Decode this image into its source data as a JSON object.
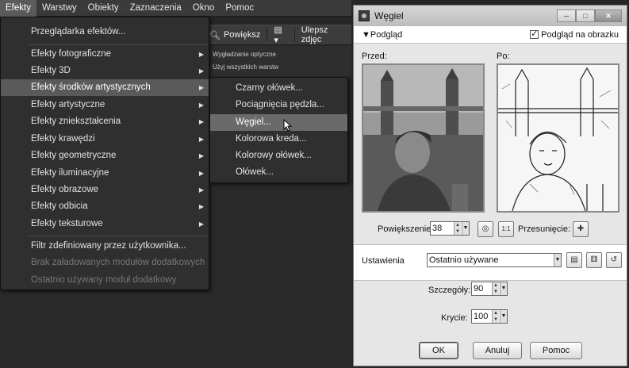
{
  "menubar": {
    "items": [
      "Efekty",
      "Warstwy",
      "Obiekty",
      "Zaznaczenia",
      "Okno",
      "Pomoc"
    ]
  },
  "toolbar": {
    "zoom_label": "Powiększ",
    "enhance_label": "Ulepsz zdjęc"
  },
  "panel": {
    "items": [
      "Wygładzanie optyczne",
      "Użyj wszystkich warstw"
    ]
  },
  "menu": {
    "items": [
      {
        "label": "Przeglądarka efektów...",
        "submenu": false,
        "disabled": false
      },
      {
        "label": "Efekty fotograficzne",
        "submenu": true,
        "disabled": false
      },
      {
        "label": "Efekty 3D",
        "submenu": true,
        "disabled": false
      },
      {
        "label": "Efekty środków artystycznych",
        "submenu": true,
        "disabled": false,
        "selected": true
      },
      {
        "label": "Efekty artystyczne",
        "submenu": true,
        "disabled": false
      },
      {
        "label": "Efekty zniekształcenia",
        "submenu": true,
        "disabled": false
      },
      {
        "label": "Efekty krawędzi",
        "submenu": true,
        "disabled": false
      },
      {
        "label": "Efekty geometryczne",
        "submenu": true,
        "disabled": false
      },
      {
        "label": "Efekty iluminacyjne",
        "submenu": true,
        "disabled": false
      },
      {
        "label": "Efekty obrazowe",
        "submenu": true,
        "disabled": false
      },
      {
        "label": "Efekty odbicia",
        "submenu": true,
        "disabled": false
      },
      {
        "label": "Efekty teksturowe",
        "submenu": true,
        "disabled": false
      },
      {
        "label": "Filtr zdefiniowany przez użytkownika...",
        "submenu": false,
        "disabled": false
      },
      {
        "label": "Brak załadowanych modułów dodatkowych",
        "submenu": false,
        "disabled": true
      },
      {
        "label": "Ostatnio używany moduł dodatkowy",
        "submenu": false,
        "disabled": true
      }
    ]
  },
  "submenu": {
    "items": [
      "Czarny ołówek...",
      "Pociągnięcia pędzla...",
      "Węgiel...",
      "Kolorowa kreda...",
      "Kolorowy ołówek...",
      "Ołówek..."
    ],
    "selected_index": 2
  },
  "dialog": {
    "title": "Węgiel",
    "preview_toggle": "Podgląd",
    "preview_on_image": "Podgląd na obrazku",
    "before_label": "Przed:",
    "after_label": "Po:",
    "zoom_label": "Powiększenie:",
    "zoom_value": "38",
    "pan_label": "Przesunięcie:",
    "settings_label": "Ustawienia",
    "settings_value": "Ostatnio używane",
    "detail_label": "Szczegóły:",
    "detail_value": "90",
    "opacity_label": "Krycie:",
    "opacity_value": "100",
    "ok_label": "OK",
    "cancel_label": "Anuluj",
    "help_label": "Pomoc"
  }
}
